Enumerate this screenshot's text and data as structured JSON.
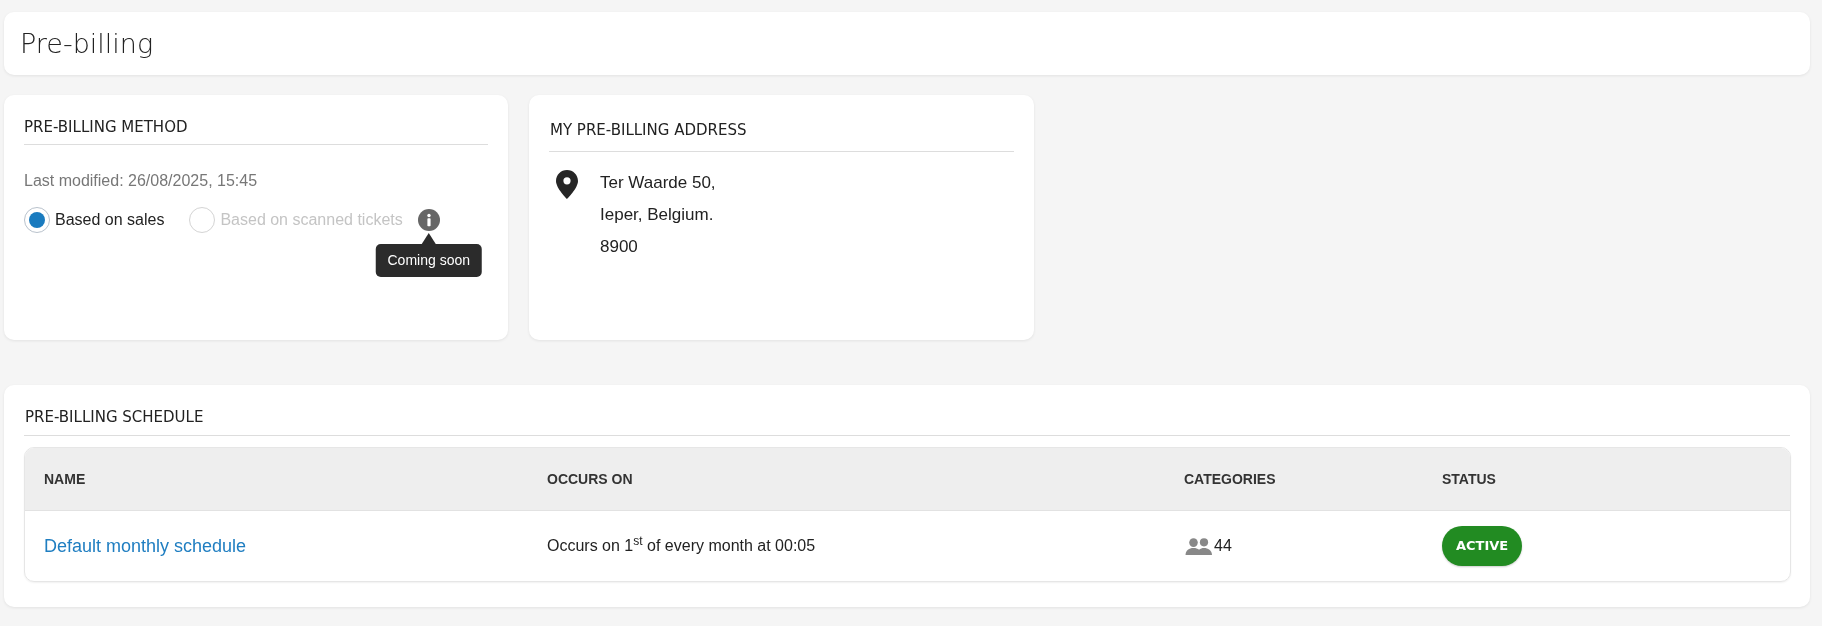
{
  "page": {
    "title": "Pre-billing"
  },
  "method_card": {
    "heading": "PRE-BILLING METHOD",
    "last_modified": "Last modified: 26/08/2025, 15:45",
    "options": [
      {
        "label": "Based on sales",
        "selected": true,
        "disabled": false
      },
      {
        "label": "Based on scanned tickets",
        "selected": false,
        "disabled": true,
        "tooltip": "Coming soon"
      }
    ]
  },
  "address_card": {
    "heading": "MY PRE-BILLING ADDRESS",
    "lines": [
      "Ter Waarde 50,",
      "Ieper, Belgium.",
      "8900"
    ]
  },
  "schedule_card": {
    "heading": "PRE-BILLING SCHEDULE",
    "table": {
      "columns": [
        "NAME",
        "OCCURS ON",
        "CATEGORIES",
        "STATUS"
      ],
      "rows": [
        {
          "name": "Default monthly schedule",
          "occurs_on": "Occurs on 1$^{st}$ of every month at 00:05",
          "categories": "44",
          "status": {
            "label": "ACTIVE",
            "color": "#228b22"
          }
        }
      ]
    }
  }
}
